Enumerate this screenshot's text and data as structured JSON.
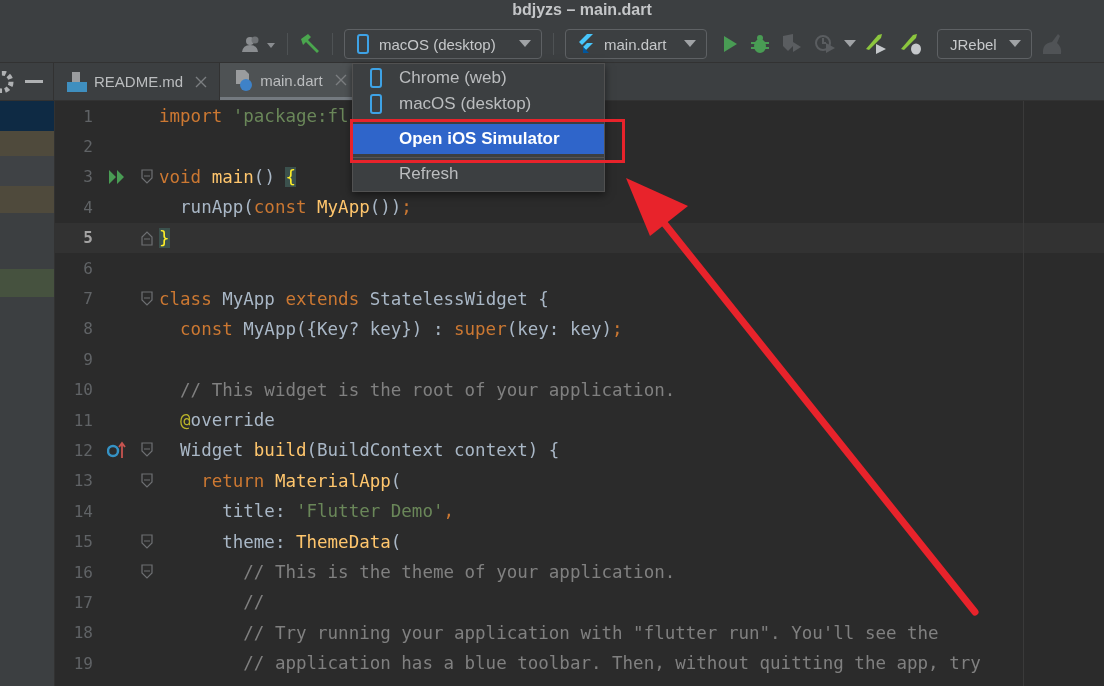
{
  "window": {
    "title": "bdjyzs – main.dart"
  },
  "toolbar": {
    "device_selector": {
      "value": "macOS (desktop)"
    },
    "config_selector": {
      "value": "main.dart"
    },
    "plugin_selector": {
      "value": "JRebel"
    }
  },
  "tabs": [
    {
      "label": "README.md",
      "kind": "markdown",
      "selected": false
    },
    {
      "label": "main.dart",
      "kind": "dart",
      "selected": true
    }
  ],
  "device_menu": {
    "items": [
      {
        "label": "Chrome (web)",
        "kind": "device",
        "selected": false
      },
      {
        "label": "macOS (desktop)",
        "kind": "device",
        "selected": false
      },
      {
        "label": "Open iOS Simulator",
        "kind": "action",
        "selected": true
      },
      {
        "label": "Refresh",
        "kind": "action",
        "selected": false
      }
    ]
  },
  "editor": {
    "lines": [
      {
        "number": "1",
        "current": false,
        "tokens": [
          {
            "kind": "keyword",
            "text": "import "
          },
          {
            "kind": "string",
            "text": "'package:fl"
          }
        ]
      },
      {
        "number": "2",
        "current": false
      },
      {
        "number": "3",
        "current": false,
        "run_marker": true,
        "fold_start": true,
        "tokens": [
          {
            "kind": "keyword",
            "text": "void "
          },
          {
            "kind": "function",
            "text": "main"
          },
          {
            "kind": "plain",
            "text": "() "
          },
          {
            "kind": "brace",
            "text": "{"
          }
        ]
      },
      {
        "number": "4",
        "current": false,
        "tokens": [
          {
            "kind": "plain",
            "text": "  runApp("
          },
          {
            "kind": "keyword",
            "text": "const "
          },
          {
            "kind": "function",
            "text": "MyApp"
          },
          {
            "kind": "plain",
            "text": "())"
          },
          {
            "kind": "keyword",
            "text": ";"
          }
        ]
      },
      {
        "number": "5",
        "current": true,
        "fold_end": true,
        "tokens": [
          {
            "kind": "brace",
            "text": "}"
          }
        ]
      },
      {
        "number": "6",
        "current": false
      },
      {
        "number": "7",
        "current": false,
        "fold_start": true,
        "tokens": [
          {
            "kind": "keyword",
            "text": "class "
          },
          {
            "kind": "plain",
            "text": "MyApp "
          },
          {
            "kind": "keyword",
            "text": "extends "
          },
          {
            "kind": "plain",
            "text": "StatelessWidget {"
          }
        ]
      },
      {
        "number": "8",
        "current": false,
        "tokens": [
          {
            "kind": "keyword",
            "text": "  const "
          },
          {
            "kind": "plain",
            "text": "MyApp({Key? key}) : "
          },
          {
            "kind": "keyword",
            "text": "super"
          },
          {
            "kind": "plain",
            "text": "(key: key)"
          },
          {
            "kind": "keyword",
            "text": ";"
          }
        ]
      },
      {
        "number": "9",
        "current": false
      },
      {
        "number": "10",
        "current": false,
        "tokens": [
          {
            "kind": "comment",
            "text": "  // This widget is the root of your application."
          }
        ]
      },
      {
        "number": "11",
        "current": false,
        "tokens": [
          {
            "kind": "annotation",
            "text": "  @"
          },
          {
            "kind": "plain",
            "text": "override"
          }
        ]
      },
      {
        "number": "12",
        "current": false,
        "override_marker": true,
        "fold_start": true,
        "tokens": [
          {
            "kind": "plain",
            "text": "  Widget "
          },
          {
            "kind": "function",
            "text": "build"
          },
          {
            "kind": "plain",
            "text": "(BuildContext context) {"
          }
        ]
      },
      {
        "number": "13",
        "current": false,
        "fold_start": true,
        "tokens": [
          {
            "kind": "keyword",
            "text": "    return "
          },
          {
            "kind": "function",
            "text": "MaterialApp"
          },
          {
            "kind": "plain",
            "text": "("
          }
        ]
      },
      {
        "number": "14",
        "current": false,
        "tokens": [
          {
            "kind": "plain",
            "text": "      title: "
          },
          {
            "kind": "string",
            "text": "'Flutter Demo'"
          },
          {
            "kind": "keyword",
            "text": ","
          }
        ]
      },
      {
        "number": "15",
        "current": false,
        "fold_start": true,
        "tokens": [
          {
            "kind": "plain",
            "text": "      theme: "
          },
          {
            "kind": "function",
            "text": "ThemeData"
          },
          {
            "kind": "plain",
            "text": "("
          }
        ]
      },
      {
        "number": "16",
        "current": false,
        "fold_start": true,
        "tokens": [
          {
            "kind": "comment",
            "text": "        // This is the theme of your application."
          }
        ]
      },
      {
        "number": "17",
        "current": false,
        "tokens": [
          {
            "kind": "comment",
            "text": "        //"
          }
        ]
      },
      {
        "number": "18",
        "current": false,
        "tokens": [
          {
            "kind": "comment",
            "text": "        // Try running your application with \"flutter run\". You'll see the"
          }
        ]
      },
      {
        "number": "19",
        "current": false,
        "tokens": [
          {
            "kind": "comment",
            "text": "        // application has a blue toolbar. Then, without quitting the app, try"
          }
        ]
      }
    ]
  }
}
